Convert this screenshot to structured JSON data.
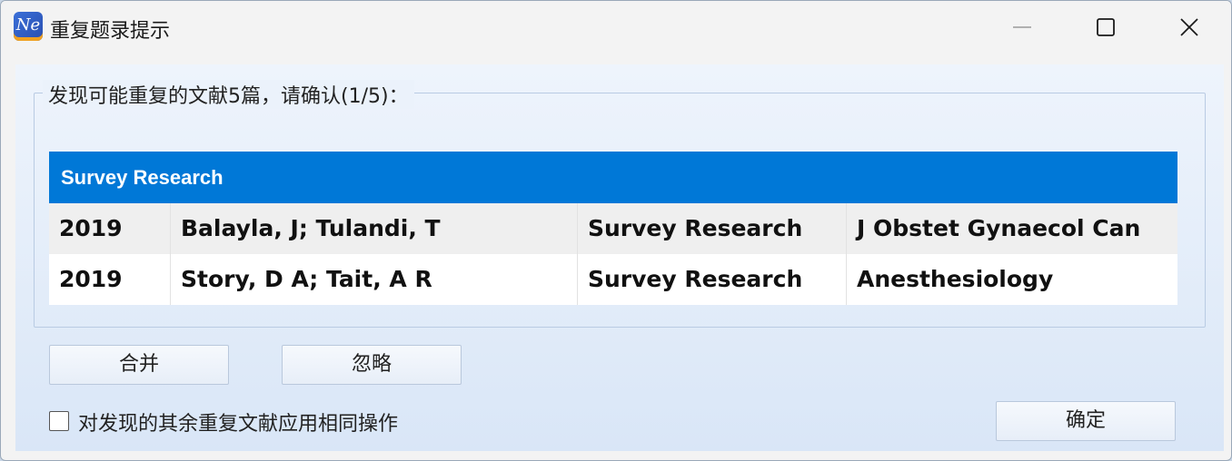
{
  "window": {
    "title": "重复题录提示",
    "app_icon_text": "Ne"
  },
  "group": {
    "caption": "发现可能重复的文献5篇，请确认(1/5)："
  },
  "list": {
    "header": "Survey Research",
    "rows": [
      {
        "year": "2019",
        "authors": "Balayla, J; Tulandi, T",
        "title": "Survey Research",
        "journal": "J Obstet Gynaecol Can"
      },
      {
        "year": "2019",
        "authors": "Story, D A; Tait, A R",
        "title": "Survey Research",
        "journal": "Anesthesiology"
      }
    ]
  },
  "buttons": {
    "merge": "合并",
    "ignore": "忽略",
    "ok": "确定"
  },
  "checkbox": {
    "label": "对发现的其余重复文献应用相同操作",
    "checked": false
  },
  "colors": {
    "header_blue": "#0078d7"
  }
}
